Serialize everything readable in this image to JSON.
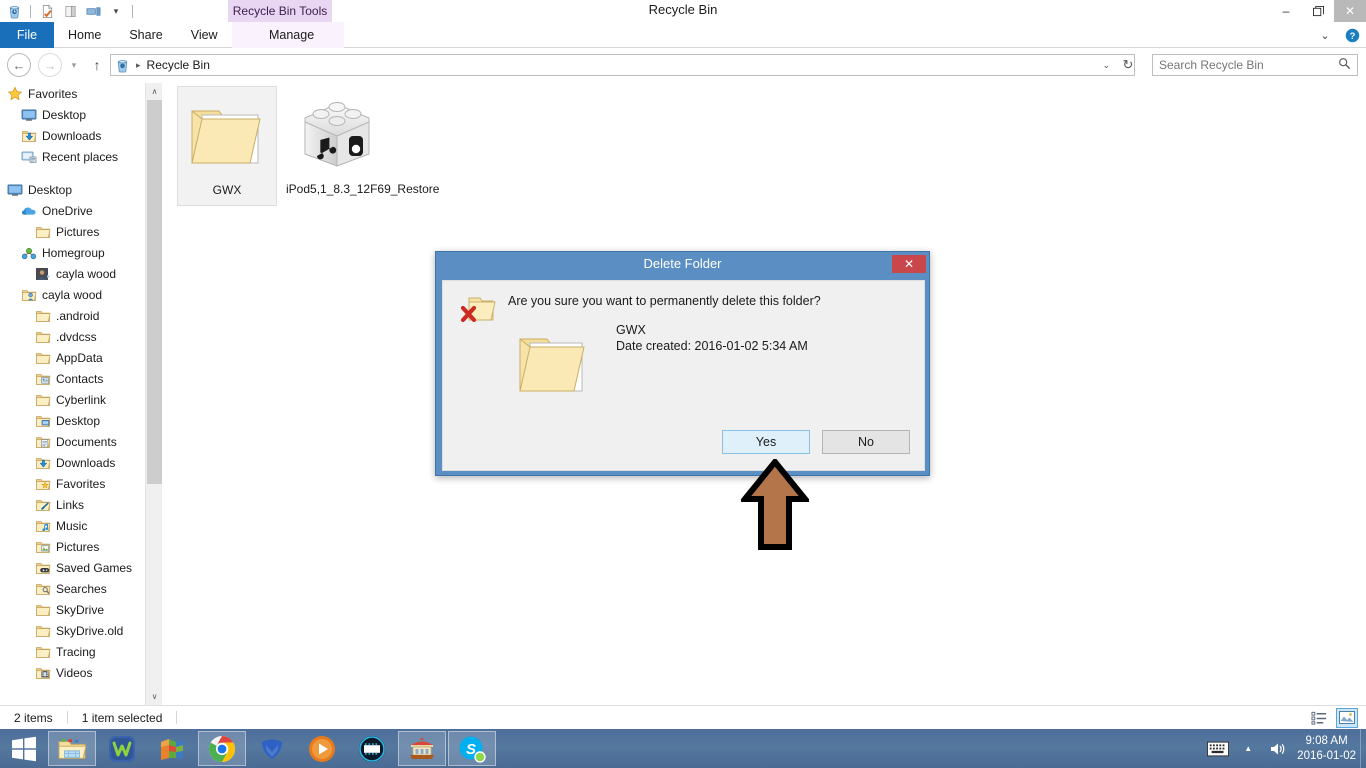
{
  "window": {
    "title": "Recycle Bin",
    "context_tab_label": "Recycle Bin Tools",
    "minimize_glyph": "–",
    "maximize_glyph": "❐",
    "close_glyph": "✕",
    "help_glyph": "?",
    "ribbon_collapse_glyph": "⌄"
  },
  "quick_access": {
    "items": [
      {
        "name": "recycle-bin-icon",
        "tooltip": "Recycle Bin"
      },
      {
        "name": "properties-icon",
        "tooltip": "Properties"
      },
      {
        "name": "new-folder-icon",
        "tooltip": "New folder"
      },
      {
        "name": "customize-icon",
        "tooltip": "Customize Quick Access Toolbar"
      },
      {
        "name": "dropdown-icon",
        "glyph": "▾"
      }
    ]
  },
  "ribbon": {
    "tabs": [
      {
        "label": "File",
        "state": "file"
      },
      {
        "label": "Home",
        "state": "normal"
      },
      {
        "label": "Share",
        "state": "normal"
      },
      {
        "label": "View",
        "state": "normal"
      },
      {
        "label": "Manage",
        "state": "context"
      }
    ]
  },
  "addressbar": {
    "back_glyph": "←",
    "forward_glyph": "→",
    "recent_glyph": "▾",
    "up_glyph": "↑",
    "location_icon": "recycle-bin-icon",
    "crumb": "Recycle Bin",
    "crumb_sep": "▸",
    "chevron_glyph": "⌄",
    "refresh_glyph": "↻"
  },
  "search": {
    "placeholder": "Search Recycle Bin",
    "value": "",
    "icon": "search-icon"
  },
  "navpane": {
    "items": [
      {
        "label": "Favorites",
        "icon": "star-icon",
        "indent": 0
      },
      {
        "label": "Desktop",
        "icon": "monitor-icon",
        "indent": 1
      },
      {
        "label": "Downloads",
        "icon": "downloads-icon",
        "indent": 1
      },
      {
        "label": "Recent places",
        "icon": "recent-icon",
        "indent": 1
      },
      {
        "label": "",
        "icon": "spacer",
        "indent": 0
      },
      {
        "label": "Desktop",
        "icon": "monitor-icon",
        "indent": 0
      },
      {
        "label": "OneDrive",
        "icon": "cloud-icon",
        "indent": 1
      },
      {
        "label": "Pictures",
        "icon": "folder-icon",
        "indent": 2
      },
      {
        "label": "Homegroup",
        "icon": "homegroup-icon",
        "indent": 1
      },
      {
        "label": "cayla wood",
        "icon": "user-photo-icon",
        "indent": 2
      },
      {
        "label": "cayla wood",
        "icon": "user-folder-icon",
        "indent": 1
      },
      {
        "label": ".android",
        "icon": "folder-icon",
        "indent": 2
      },
      {
        "label": ".dvdcss",
        "icon": "folder-icon",
        "indent": 2
      },
      {
        "label": "AppData",
        "icon": "folder-icon",
        "indent": 2
      },
      {
        "label": "Contacts",
        "icon": "contacts-icon",
        "indent": 2
      },
      {
        "label": "Cyberlink",
        "icon": "folder-icon",
        "indent": 2
      },
      {
        "label": "Desktop",
        "icon": "desktop-folder-icon",
        "indent": 2
      },
      {
        "label": "Documents",
        "icon": "documents-icon",
        "indent": 2
      },
      {
        "label": "Downloads",
        "icon": "downloads-icon",
        "indent": 2
      },
      {
        "label": "Favorites",
        "icon": "favorites-icon",
        "indent": 2
      },
      {
        "label": "Links",
        "icon": "links-icon",
        "indent": 2
      },
      {
        "label": "Music",
        "icon": "music-icon",
        "indent": 2
      },
      {
        "label": "Pictures",
        "icon": "pictures-icon",
        "indent": 2
      },
      {
        "label": "Saved Games",
        "icon": "saved-games-icon",
        "indent": 2
      },
      {
        "label": "Searches",
        "icon": "searches-icon",
        "indent": 2
      },
      {
        "label": "SkyDrive",
        "icon": "folder-icon",
        "indent": 2
      },
      {
        "label": "SkyDrive.old",
        "icon": "folder-icon",
        "indent": 2
      },
      {
        "label": "Tracing",
        "icon": "folder-icon",
        "indent": 2
      },
      {
        "label": "Videos",
        "icon": "videos-icon",
        "indent": 2
      }
    ],
    "scroll_up_glyph": "∧",
    "scroll_down_glyph": "∨"
  },
  "content": {
    "files": [
      {
        "label": "GWX",
        "icon": "folder-windows-icon",
        "selected": true
      },
      {
        "label": "iPod5,1_8.3_12F69_Restore",
        "icon": "ipsw-icon",
        "selected": false
      }
    ]
  },
  "statusbar": {
    "item_count": "2 items",
    "selection": "1 item selected",
    "view_details_icon": "details-view-icon",
    "view_thumbnails_icon": "large-icons-view-icon"
  },
  "dialog": {
    "title": "Delete Folder",
    "close_glyph": "✕",
    "question": "Are you sure you want to permanently delete this folder?",
    "item_name": "GWX",
    "item_date": "Date created: 2016-01-02 5:34 AM",
    "buttons": [
      {
        "label": "Yes",
        "style": "primary"
      },
      {
        "label": "No",
        "style": "normal"
      }
    ],
    "warning_icon": "folder-delete-icon",
    "folder_icon": "folder-windows-icon"
  },
  "annotation": {
    "arrow_color": "#b5754a",
    "arrow_outline": "#000000",
    "points_to": "Yes"
  },
  "taskbar": {
    "start_icon": "windows-logo-icon",
    "items": [
      {
        "name": "file-explorer-icon",
        "running": true
      },
      {
        "name": "wondershare-icon",
        "running": false
      },
      {
        "name": "winrar-icon",
        "running": false
      },
      {
        "name": "google-chrome-icon",
        "running": true
      },
      {
        "name": "malwarebytes-icon",
        "running": false
      },
      {
        "name": "media-player-icon",
        "running": false
      },
      {
        "name": "video-converter-icon",
        "running": false
      },
      {
        "name": "carousel-app-icon",
        "running": true
      },
      {
        "name": "skype-icon",
        "running": true
      }
    ],
    "tray": {
      "keyboard_icon": "keyboard-icon",
      "overflow_glyph": "▲",
      "volume_icon": "speaker-icon",
      "time": "9:08 AM",
      "date": "2016-01-02"
    }
  },
  "colors": {
    "file_tab_blue": "#1a6fbb",
    "context_tab_purple": "#e9d6f2",
    "dialog_frame_blue": "#5b8fc4",
    "dialog_close_red": "#c9474b",
    "selection_blue": "#cce6f7",
    "taskbar_blue": "#4d6e99"
  }
}
